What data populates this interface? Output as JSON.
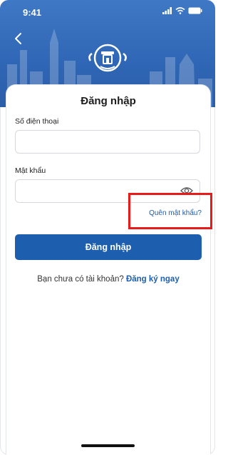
{
  "status_bar": {
    "time": "9:41"
  },
  "login": {
    "title": "Đăng nhập",
    "phone_label": "Số điện thoại",
    "phone_value": "",
    "password_label": "Mật khẩu",
    "password_value": "",
    "forgot_password": "Quên mật khẩu?",
    "submit": "Đăng nhập",
    "no_account_text": "Bạn chưa có tài khoản? ",
    "register_link": "Đăng ký ngay"
  },
  "icons": {
    "back": "back-arrow-icon",
    "eye": "eye-icon",
    "logo": "hanoi-emblem-logo"
  },
  "colors": {
    "header": "#2f66b5",
    "primary": "#1d5fae",
    "highlight": "#e81b1b"
  }
}
